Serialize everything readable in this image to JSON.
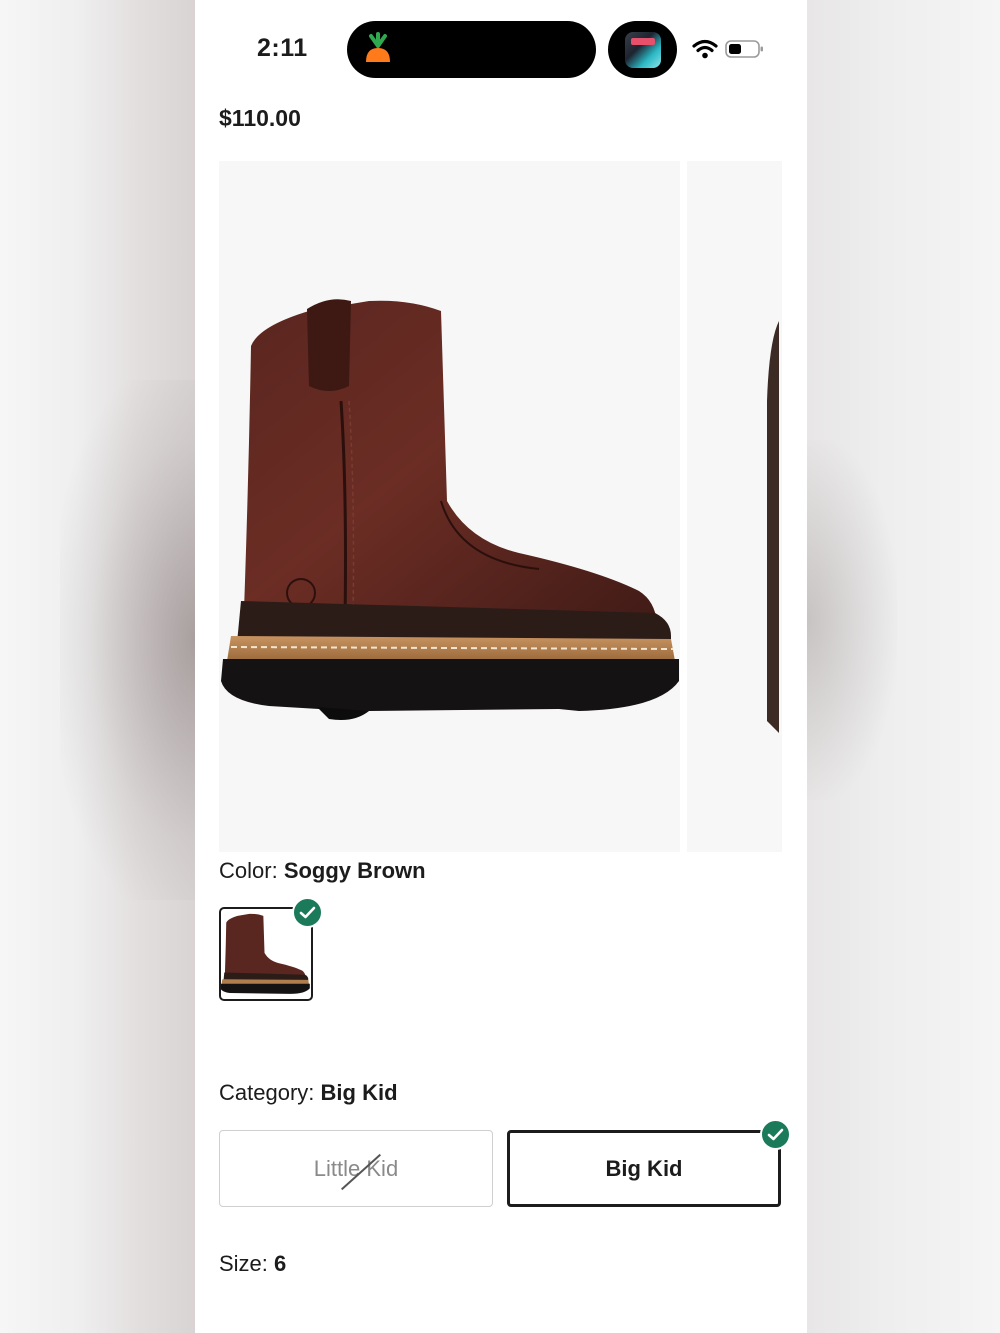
{
  "status_bar": {
    "time": "2:11",
    "carrot_icon": "carrot-app-icon",
    "now_playing_icon": "app-thumbnail-icon",
    "wifi_icon": "wifi-icon",
    "battery_icon": "battery-icon"
  },
  "product": {
    "price": "$110.00",
    "image_alt": "brown leather pull-on boot"
  },
  "color": {
    "label": "Color:",
    "value": "Soggy Brown"
  },
  "category": {
    "label": "Category:",
    "value": "Big Kid",
    "options": [
      {
        "label": "Little Kid",
        "available": false,
        "selected": false
      },
      {
        "label": "Big Kid",
        "available": true,
        "selected": true
      }
    ]
  },
  "size": {
    "label": "Size:",
    "value": "6"
  },
  "colors": {
    "accent_check": "#1b7a5a",
    "text": "#1c1c1c"
  }
}
